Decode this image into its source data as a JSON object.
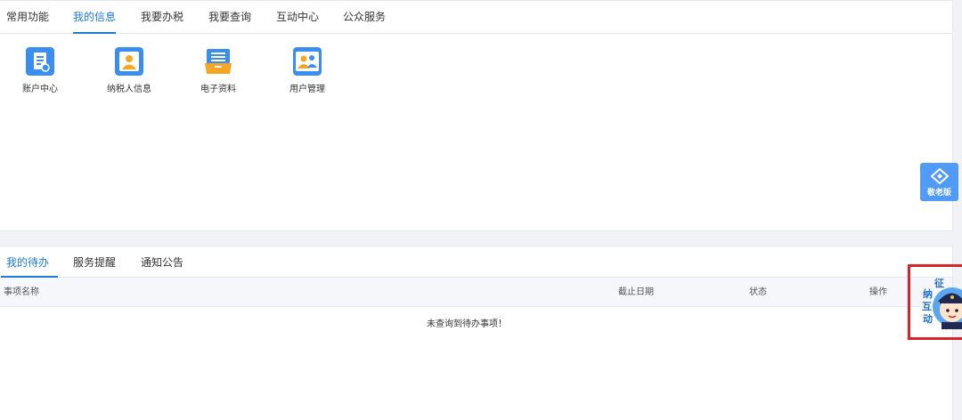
{
  "top_tabs": [
    {
      "label": "常用功能",
      "active": false
    },
    {
      "label": "我的信息",
      "active": true
    },
    {
      "label": "我要办税",
      "active": false
    },
    {
      "label": "我要查询",
      "active": false
    },
    {
      "label": "互动中心",
      "active": false
    },
    {
      "label": "公众服务",
      "active": false
    }
  ],
  "info_items": [
    {
      "label": "账户中心",
      "icon": "account-document-icon"
    },
    {
      "label": "纳税人信息",
      "icon": "taxpayer-profile-icon"
    },
    {
      "label": "电子资料",
      "icon": "electronic-files-icon"
    },
    {
      "label": "用户管理",
      "icon": "user-management-icon"
    }
  ],
  "bottom_tabs": [
    {
      "label": "我的待办",
      "active": true
    },
    {
      "label": "服务提醒",
      "active": false
    },
    {
      "label": "通知公告",
      "active": false
    }
  ],
  "table": {
    "columns": [
      "事项名称",
      "截止日期",
      "状态",
      "操作"
    ],
    "empty_message": "未查询到待办事项！"
  },
  "float": {
    "elder_mode_label": "敬老版",
    "interact_chars": [
      "征",
      "纳",
      "互",
      "动"
    ]
  },
  "colors": {
    "accent": "#1d7ad9",
    "icon_blue": "#3a8ef0",
    "icon_orange": "#f5a623",
    "elder_button": "#4f9bf5",
    "highlight": "#d9232b"
  }
}
